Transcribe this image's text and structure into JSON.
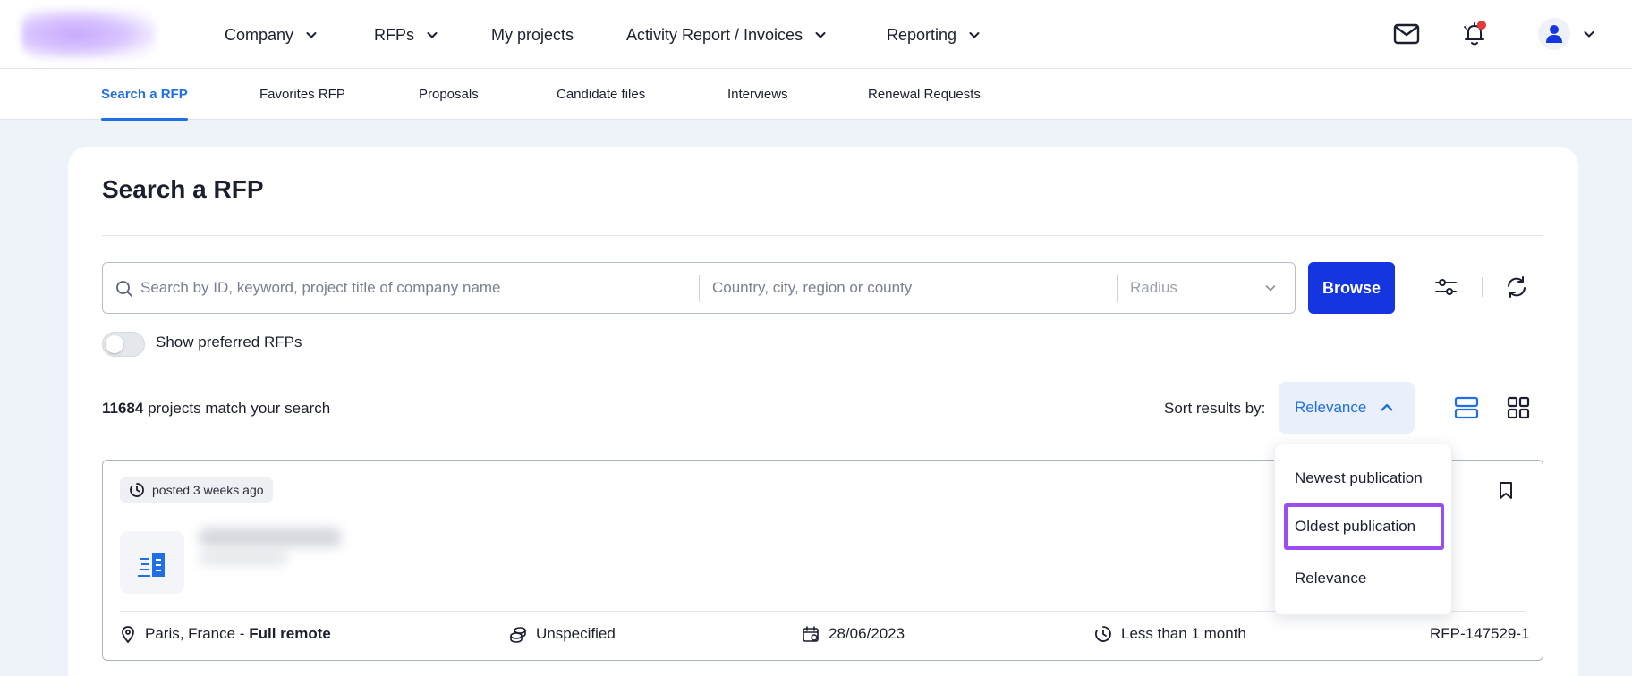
{
  "topnav": {
    "items": [
      {
        "label": "Company",
        "has_dropdown": true
      },
      {
        "label": "RFPs",
        "has_dropdown": true
      },
      {
        "label": "My projects",
        "has_dropdown": false
      },
      {
        "label": "Activity Report / Invoices",
        "has_dropdown": true
      },
      {
        "label": "Reporting",
        "has_dropdown": true
      }
    ],
    "icons": [
      "mail-icon",
      "bell-icon",
      "user-icon",
      "chevron-down-icon"
    ],
    "notification_dot_color": "#e5383b"
  },
  "subnav": {
    "tabs": [
      {
        "label": "Search a RFP",
        "active": true
      },
      {
        "label": "Favorites RFP",
        "active": false
      },
      {
        "label": "Proposals",
        "active": false
      },
      {
        "label": "Candidate files",
        "active": false
      },
      {
        "label": "Interviews",
        "active": false
      },
      {
        "label": "Renewal Requests",
        "active": false
      }
    ]
  },
  "page": {
    "title": "Search a RFP"
  },
  "search": {
    "keyword_placeholder": "Search by ID, keyword, project title of company name",
    "location_placeholder": "Country, city, region or county",
    "radius_placeholder": "Radius",
    "browse_label": "Browse"
  },
  "filters": {
    "preferred_label": "Show preferred RFPs",
    "preferred_on": false
  },
  "results": {
    "count": "11684",
    "count_suffix": " projects match your search",
    "sort_label": "Sort results by:",
    "sort_value": "Relevance",
    "sort_options": [
      "Newest publication",
      "Oldest publication",
      "Relevance"
    ],
    "highlighted_option": "Oldest publication"
  },
  "listing": {
    "posted": "posted 3 weeks ago",
    "location": "Paris, France - ",
    "remote": "Full remote",
    "budget": "Unspecified",
    "date": "28/06/2023",
    "duration": "Less than 1 month",
    "reference": "RFP-147529-1"
  },
  "colors": {
    "accent": "#1f6fe5",
    "primary_button": "#1435e0",
    "highlight_border": "#9b4ef0"
  }
}
